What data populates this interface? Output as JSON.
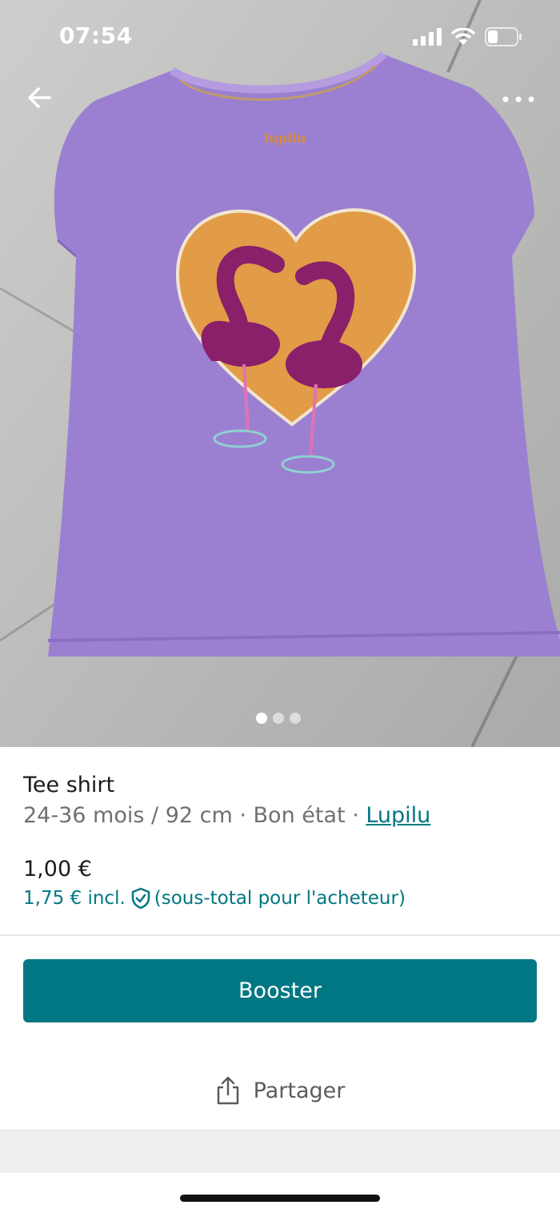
{
  "status_bar": {
    "time": "07:54"
  },
  "photo": {
    "alt": "Purple t-shirt with flamingo heart print",
    "brand_print": "lupilu",
    "pagination": {
      "count": 3,
      "active": 0
    }
  },
  "item": {
    "title": "Tee shirt",
    "size": "24-36 mois / 92 cm",
    "condition": "Bon état",
    "brand": "Lupilu",
    "separator": " · "
  },
  "pricing": {
    "price": "1,00 €",
    "incl_price": "1,75 € incl.",
    "incl_note": "(sous-total pour l'acheteur)"
  },
  "actions": {
    "booster_label": "Booster",
    "share_label": "Partager"
  },
  "colors": {
    "accent": "#007782",
    "shirt": "#9b7fd0",
    "heart": "#e39a45",
    "flamingo": "#8a1f6a"
  },
  "icons": {
    "back": "arrow-left-icon",
    "more": "more-horizontal-icon",
    "shield": "shield-check-icon",
    "share": "share-icon",
    "signal": "signal-icon",
    "wifi": "wifi-icon",
    "battery": "battery-icon"
  }
}
